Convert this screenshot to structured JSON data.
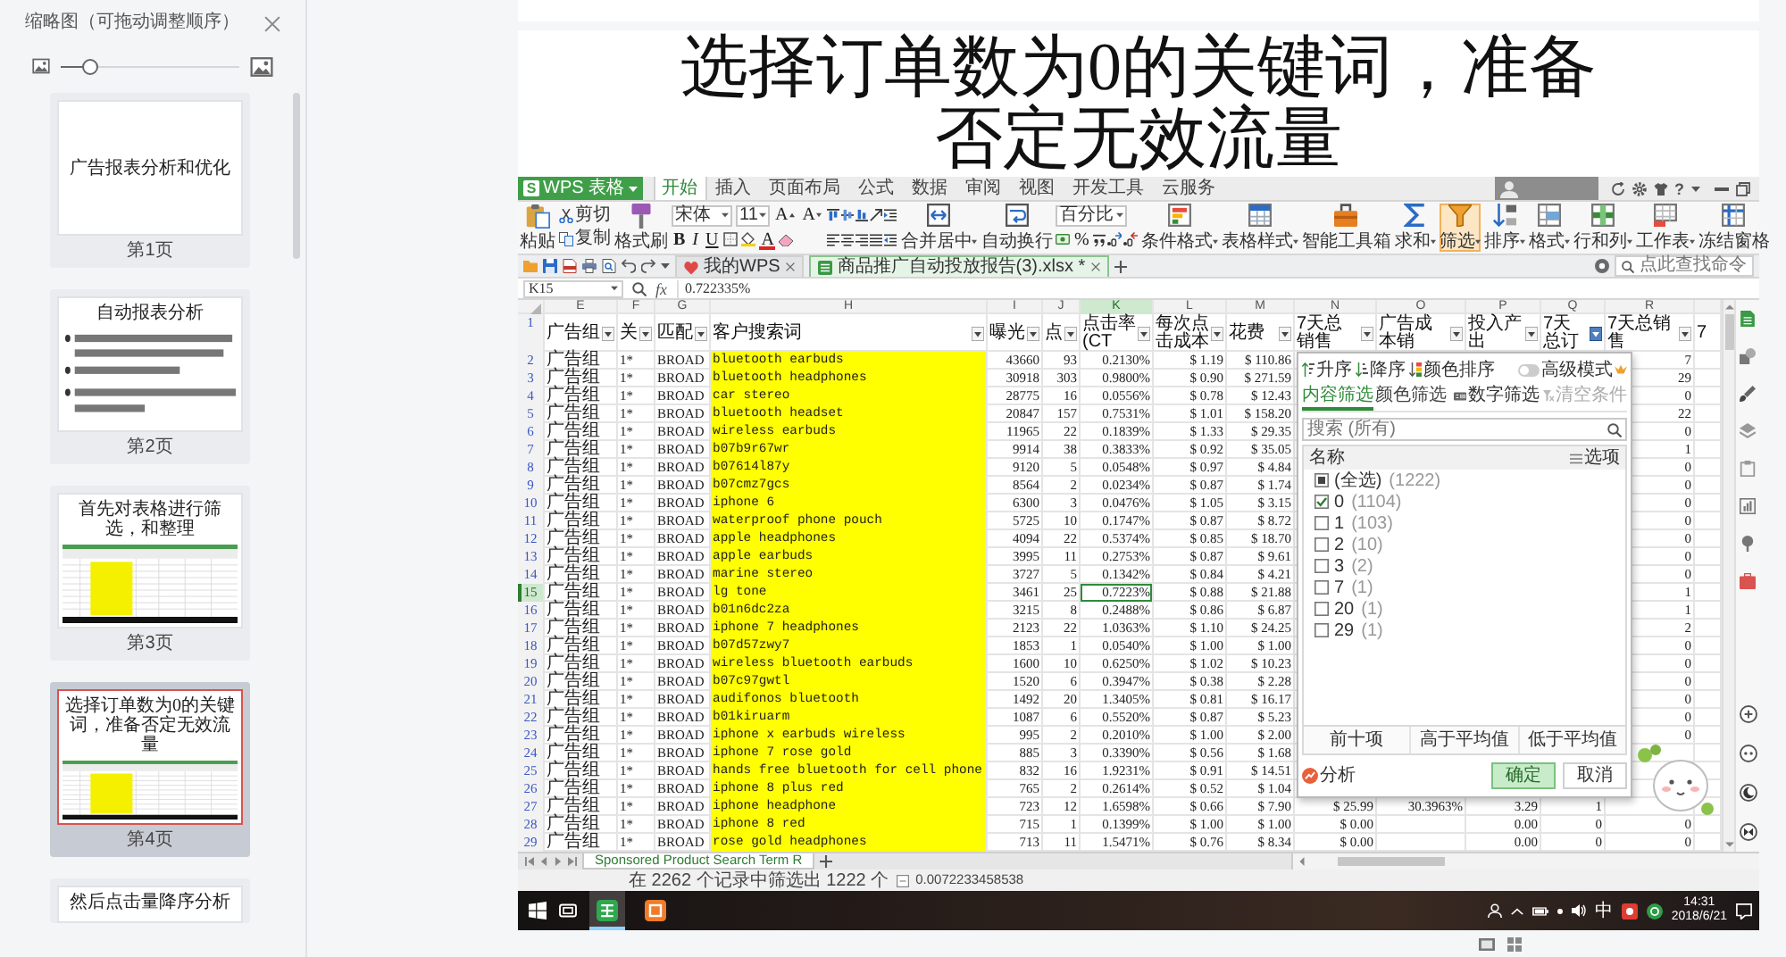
{
  "thumbnail_pane": {
    "title": "缩略图（可拖动调整顺序）",
    "size_slider": {
      "level": 0.16
    },
    "slides": [
      {
        "kind": "title",
        "title": "广告报表分析和优化",
        "label": "第1页",
        "selected": false
      },
      {
        "kind": "bullets",
        "title": "自动报表分析",
        "label": "第2页",
        "selected": false
      },
      {
        "kind": "screenshot",
        "title": "首先对表格进行筛选，和整理",
        "label": "第3页",
        "selected": false
      },
      {
        "kind": "screenshot",
        "title": "选择订单数为0的关键词，准备否定无效流量",
        "label": "第4页",
        "selected": true
      },
      {
        "kind": "screenshot",
        "title": "然后点击量降序分析",
        "selected": false
      }
    ]
  },
  "slide": {
    "title": "选择订单数为0的关键词，准备否定无效流量",
    "spreadsheet": {
      "app_button": {
        "logo": "S",
        "label": "WPS 表格"
      },
      "tabs": [
        {
          "label": "开始",
          "selected": true
        },
        {
          "label": "插入",
          "selected": false
        },
        {
          "label": "页面布局",
          "selected": false
        },
        {
          "label": "公式",
          "selected": false
        },
        {
          "label": "数据",
          "selected": false
        },
        {
          "label": "审阅",
          "selected": false
        },
        {
          "label": "视图",
          "selected": false
        },
        {
          "label": "开发工具",
          "selected": false
        },
        {
          "label": "云服务",
          "selected": false
        }
      ],
      "help": "?",
      "ribbon": {
        "paste": "粘贴",
        "cut": "剪切",
        "copy": "复制",
        "format_painter": "格式刷",
        "font": "宋体",
        "font_size": "11",
        "grow_font": "A",
        "shrink_font": "A",
        "styles": [
          "B",
          "I",
          "U"
        ],
        "font_color": "A",
        "merge": "合并居中",
        "wrap": "自动换行",
        "number_format": "百分比",
        "percent": "%",
        "tools": [
          {
            "label": "条件格式",
            "dropdown": true,
            "active": false
          },
          {
            "label": "表格样式",
            "dropdown": true,
            "active": false
          },
          {
            "label": "智能工具箱",
            "dropdown": false,
            "active": false
          },
          {
            "label": "求和",
            "dropdown": true,
            "active": false
          },
          {
            "label": "筛选",
            "dropdown": true,
            "active": true
          },
          {
            "label": "排序",
            "dropdown": true,
            "active": false
          },
          {
            "label": "格式",
            "dropdown": true,
            "active": false
          },
          {
            "label": "行和列",
            "dropdown": true,
            "active": false
          },
          {
            "label": "工作表",
            "dropdown": true,
            "active": false
          },
          {
            "label": "冻结窗格",
            "dropdown": false,
            "active": false
          }
        ]
      },
      "documents": [
        {
          "label": "我的WPS",
          "selected": false
        },
        {
          "label": "商品推广自动投放报告(3).xlsx *",
          "selected": true
        }
      ],
      "command_search": {
        "placeholder": "点此查找命令"
      },
      "name_box": "K15",
      "fx": "fx",
      "formula": "0.722335%",
      "header_row_number": "1",
      "columns": [
        {
          "letter": "E",
          "header": "广告组",
          "kind": "label",
          "filter": true,
          "menu_open": false,
          "selected": false,
          "highlighted": false
        },
        {
          "letter": "F",
          "header": "关",
          "kind": "code",
          "filter": true,
          "menu_open": false,
          "selected": false,
          "highlighted": false
        },
        {
          "letter": "G",
          "header": "匹配",
          "kind": "code",
          "filter": true,
          "menu_open": false,
          "selected": false,
          "highlighted": false
        },
        {
          "letter": "H",
          "header": "客户搜索词",
          "kind": "term",
          "filter": true,
          "menu_open": false,
          "selected": false,
          "highlighted": true
        },
        {
          "letter": "I",
          "header": "曝光",
          "kind": "number",
          "filter": true,
          "menu_open": false,
          "selected": false,
          "highlighted": false
        },
        {
          "letter": "J",
          "header": "点",
          "kind": "number",
          "filter": true,
          "menu_open": false,
          "selected": false,
          "highlighted": false
        },
        {
          "letter": "K",
          "header": "点击率(CT",
          "kind": "number",
          "filter": true,
          "menu_open": false,
          "selected": true,
          "highlighted": false
        },
        {
          "letter": "L",
          "header": "每次点击成本",
          "kind": "number",
          "filter": true,
          "menu_open": false,
          "selected": false,
          "highlighted": false
        },
        {
          "letter": "M",
          "header": "花费",
          "kind": "number",
          "filter": true,
          "menu_open": false,
          "selected": false,
          "highlighted": false
        },
        {
          "letter": "N",
          "header": "7天总销售",
          "kind": "number",
          "filter": true,
          "menu_open": false,
          "selected": false,
          "highlighted": false
        },
        {
          "letter": "O",
          "header": "广告成本销",
          "kind": "number",
          "filter": true,
          "menu_open": false,
          "selected": false,
          "highlighted": false
        },
        {
          "letter": "P",
          "header": "投入产出",
          "kind": "number",
          "filter": true,
          "menu_open": false,
          "selected": false,
          "highlighted": false
        },
        {
          "letter": "Q",
          "header": "7天总订",
          "kind": "number",
          "filter": true,
          "menu_open": true,
          "selected": false,
          "highlighted": false
        },
        {
          "letter": "R",
          "header": "7天总销售",
          "kind": "number",
          "filter": true,
          "menu_open": false,
          "selected": false,
          "highlighted": false
        },
        {
          "header": "7",
          "kind": "number",
          "filter": false,
          "menu_open": false,
          "selected": false,
          "highlighted": false
        }
      ],
      "rows": [
        {
          "number": "2",
          "selected": false,
          "cells": [
            "广告组",
            "1*",
            "BROAD",
            "bluetooth earbuds",
            "43660",
            "93",
            "0.2130%",
            "$ 1.19",
            "$ 110.86",
            null,
            null,
            null,
            null,
            "7"
          ]
        },
        {
          "number": "3",
          "selected": false,
          "cells": [
            "广告组",
            "1*",
            "BROAD",
            "bluetooth headphones",
            "30918",
            "303",
            "0.9800%",
            "$ 0.90",
            "$ 271.59",
            null,
            null,
            null,
            null,
            "29"
          ]
        },
        {
          "number": "4",
          "selected": false,
          "cells": [
            "广告组",
            "1*",
            "BROAD",
            "car stereo",
            "28775",
            "16",
            "0.0556%",
            "$ 0.78",
            "$ 12.43",
            null,
            null,
            null,
            null,
            "0"
          ]
        },
        {
          "number": "5",
          "selected": false,
          "cells": [
            "广告组",
            "1*",
            "BROAD",
            "bluetooth headset",
            "20847",
            "157",
            "0.7531%",
            "$ 1.01",
            "$ 158.20",
            null,
            null,
            null,
            null,
            "22"
          ]
        },
        {
          "number": "6",
          "selected": false,
          "cells": [
            "广告组",
            "1*",
            "BROAD",
            "wireless earbuds",
            "11965",
            "22",
            "0.1839%",
            "$ 1.33",
            "$ 29.35",
            null,
            null,
            null,
            null,
            "0"
          ]
        },
        {
          "number": "7",
          "selected": false,
          "cells": [
            "广告组",
            "1*",
            "BROAD",
            "b07b9r67wr",
            "9914",
            "38",
            "0.3833%",
            "$ 0.92",
            "$ 35.05",
            null,
            null,
            null,
            null,
            "1"
          ]
        },
        {
          "number": "8",
          "selected": false,
          "cells": [
            "广告组",
            "1*",
            "BROAD",
            "b07614l87y",
            "9120",
            "5",
            "0.0548%",
            "$ 0.97",
            "$ 4.84",
            null,
            null,
            null,
            null,
            "0"
          ]
        },
        {
          "number": "9",
          "selected": false,
          "cells": [
            "广告组",
            "1*",
            "BROAD",
            "b07cmz7gcs",
            "8564",
            "2",
            "0.0234%",
            "$ 0.87",
            "$ 1.74",
            null,
            null,
            null,
            null,
            "0"
          ]
        },
        {
          "number": "10",
          "selected": false,
          "cells": [
            "广告组",
            "1*",
            "BROAD",
            "iphone 6",
            "6300",
            "3",
            "0.0476%",
            "$ 1.05",
            "$ 3.15",
            null,
            null,
            null,
            null,
            "0"
          ]
        },
        {
          "number": "11",
          "selected": false,
          "cells": [
            "广告组",
            "1*",
            "BROAD",
            "waterproof phone pouch",
            "5725",
            "10",
            "0.1747%",
            "$ 0.87",
            "$ 8.72",
            null,
            null,
            null,
            null,
            "0"
          ]
        },
        {
          "number": "12",
          "selected": false,
          "cells": [
            "广告组",
            "1*",
            "BROAD",
            "apple headphones",
            "4094",
            "22",
            "0.5374%",
            "$ 0.85",
            "$ 18.70",
            null,
            null,
            null,
            null,
            "0"
          ]
        },
        {
          "number": "13",
          "selected": false,
          "cells": [
            "广告组",
            "1*",
            "BROAD",
            "apple earbuds",
            "3995",
            "11",
            "0.2753%",
            "$ 0.87",
            "$ 9.61",
            null,
            null,
            null,
            null,
            "0"
          ]
        },
        {
          "number": "14",
          "selected": false,
          "cells": [
            "广告组",
            "1*",
            "BROAD",
            "marine stereo",
            "3727",
            "5",
            "0.1342%",
            "$ 0.84",
            "$ 4.21",
            null,
            null,
            null,
            null,
            "0"
          ]
        },
        {
          "number": "15",
          "selected": true,
          "cells": [
            "广告组",
            "1*",
            "BROAD",
            "lg tone",
            "3461",
            "25",
            "0.7223%",
            "$ 0.88",
            "$ 21.88",
            null,
            null,
            null,
            null,
            "1"
          ]
        },
        {
          "number": "16",
          "selected": false,
          "cells": [
            "广告组",
            "1*",
            "BROAD",
            "b01n6dc2za",
            "3215",
            "8",
            "0.2488%",
            "$ 0.86",
            "$ 6.87",
            null,
            null,
            null,
            null,
            "1"
          ]
        },
        {
          "number": "17",
          "selected": false,
          "cells": [
            "广告组",
            "1*",
            "BROAD",
            "iphone 7 headphones",
            "2123",
            "22",
            "1.0363%",
            "$ 1.10",
            "$ 24.25",
            null,
            null,
            null,
            null,
            "2"
          ]
        },
        {
          "number": "18",
          "selected": false,
          "cells": [
            "广告组",
            "1*",
            "BROAD",
            "b07d57zwy7",
            "1853",
            "1",
            "0.0540%",
            "$ 1.00",
            "$ 1.00",
            null,
            null,
            null,
            null,
            "0"
          ]
        },
        {
          "number": "19",
          "selected": false,
          "cells": [
            "广告组",
            "1*",
            "BROAD",
            "wireless bluetooth earbuds",
            "1600",
            "10",
            "0.6250%",
            "$ 1.02",
            "$ 10.23",
            null,
            null,
            null,
            null,
            "0"
          ]
        },
        {
          "number": "20",
          "selected": false,
          "cells": [
            "广告组",
            "1*",
            "BROAD",
            "b07c97gwtl",
            "1520",
            "6",
            "0.3947%",
            "$ 0.38",
            "$ 2.28",
            null,
            null,
            null,
            null,
            "0"
          ]
        },
        {
          "number": "21",
          "selected": false,
          "cells": [
            "广告组",
            "1*",
            "BROAD",
            "audifonos bluetooth",
            "1492",
            "20",
            "1.3405%",
            "$ 0.81",
            "$ 16.17",
            null,
            null,
            null,
            null,
            "0"
          ]
        },
        {
          "number": "22",
          "selected": false,
          "cells": [
            "广告组",
            "1*",
            "BROAD",
            "b01kiruarm",
            "1087",
            "6",
            "0.5520%",
            "$ 0.87",
            "$ 5.23",
            null,
            null,
            null,
            null,
            "0"
          ]
        },
        {
          "number": "23",
          "selected": false,
          "cells": [
            "广告组",
            "1*",
            "BROAD",
            "iphone x earbuds wireless",
            "995",
            "2",
            "0.2010%",
            "$ 1.00",
            "$ 2.00",
            null,
            null,
            null,
            null,
            "0"
          ]
        },
        {
          "number": "24",
          "selected": false,
          "cells": [
            "广告组",
            "1*",
            "BROAD",
            "iphone 7 rose gold",
            "885",
            "3",
            "0.3390%",
            "$ 0.56",
            "$ 1.68",
            null,
            null,
            null,
            null,
            null
          ]
        },
        {
          "number": "25",
          "selected": false,
          "cells": [
            "广告组",
            "1*",
            "BROAD",
            "hands free bluetooth for cell phone",
            "832",
            "16",
            "1.9231%",
            "$ 0.91",
            "$ 14.51",
            null,
            null,
            null,
            null,
            null
          ]
        },
        {
          "number": "26",
          "selected": false,
          "cells": [
            "广告组",
            "1*",
            "BROAD",
            "iphone 8 plus red",
            "765",
            "2",
            "0.2614%",
            "$ 0.52",
            "$ 1.04",
            null,
            null,
            null,
            null,
            null
          ]
        },
        {
          "number": "27",
          "selected": false,
          "cells": [
            "广告组",
            "1*",
            "BROAD",
            "iphone headphone",
            "723",
            "12",
            "1.6598%",
            "$ 0.66",
            "$ 7.90",
            "$ 25.99",
            "30.3963%",
            "3.29",
            "1",
            null
          ]
        },
        {
          "number": "28",
          "selected": false,
          "cells": [
            "广告组",
            "1*",
            "BROAD",
            "iphone 8 red",
            "715",
            "1",
            "0.1399%",
            "$ 1.00",
            "$ 1.00",
            "$ 0.00",
            null,
            "0.00",
            "0",
            "0"
          ]
        },
        {
          "number": "29",
          "selected": false,
          "cells": [
            "广告组",
            "1*",
            "BROAD",
            "rose gold headphones",
            "713",
            "11",
            "1.5471%",
            "$ 0.76",
            "$ 8.34",
            "$ 0.00",
            null,
            "0.00",
            "0",
            "0"
          ]
        }
      ],
      "filter_dialog": {
        "sort_buttons": [
          "升序",
          "降序",
          "颜色排序"
        ],
        "advanced_mode": {
          "label": "高级模式",
          "on": false
        },
        "tabs": [
          {
            "label": "内容筛选",
            "selected": true
          },
          {
            "label": "颜色筛选",
            "selected": false
          }
        ],
        "number_filter": "数字筛选",
        "clear": {
          "label": "清空条件",
          "disabled": true
        },
        "search": {
          "placeholder": "搜索 (所有)"
        },
        "list_header": "名称",
        "options": "选项",
        "items": [
          {
            "label": "(全选)",
            "count": "(1222)",
            "checked": false,
            "mixed": true
          },
          {
            "label": "0",
            "count": "(1104)",
            "checked": true,
            "mixed": false
          },
          {
            "label": "1",
            "count": "(103)",
            "checked": false,
            "mixed": false
          },
          {
            "label": "2",
            "count": "(10)",
            "checked": false,
            "mixed": false
          },
          {
            "label": "3",
            "count": "(2)",
            "checked": false,
            "mixed": false
          },
          {
            "label": "7",
            "count": "(1)",
            "checked": false,
            "mixed": false
          },
          {
            "label": "20",
            "count": "(1)",
            "checked": false,
            "mixed": false
          },
          {
            "label": "29",
            "count": "(1)",
            "checked": false,
            "mixed": false
          }
        ],
        "quick_buttons": [
          "前十项",
          "高于平均值",
          "低于平均值"
        ],
        "analyze": "分析",
        "ok": "确定",
        "cancel": "取消"
      },
      "sheet_tabs": [
        {
          "label": "Sponsored Product Search Term R",
          "selected": true
        }
      ],
      "status": {
        "text": "在 2262 个记录中筛选出 1222 个",
        "value": "0.0072233458538"
      },
      "taskbar": {
        "apps": [
          {
            "active": true
          },
          {
            "active": false
          }
        ],
        "ime": "中",
        "time": "14:31",
        "date": "2018/6/21"
      }
    }
  }
}
